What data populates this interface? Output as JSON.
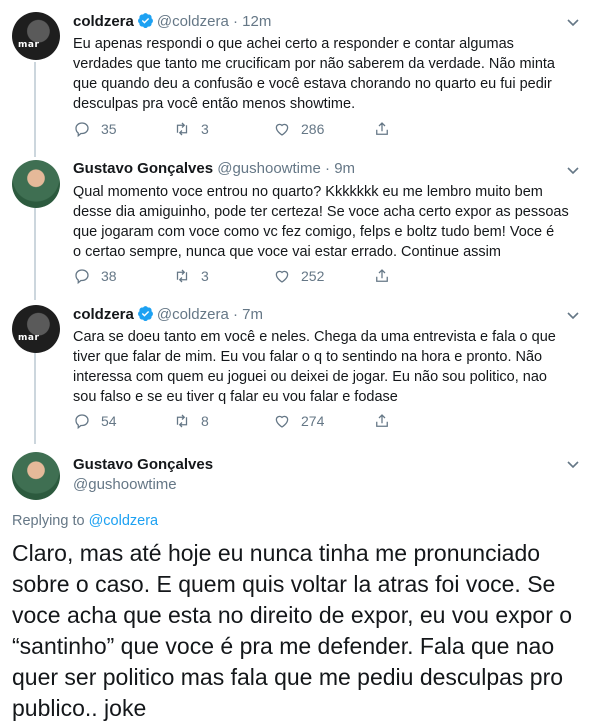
{
  "tweets": [
    {
      "name": "coldzera",
      "verified": true,
      "handle": "@coldzera",
      "dot": "·",
      "time": "12m",
      "avatar_label": "mar",
      "lines": [
        "Eu apenas respondi o que achei certo a responder e contar algumas",
        "verdades que tanto me crucificam por não saberem da verdade. Não minta",
        "que quando deu a confusão e você estava chorando no quarto eu fui pedir",
        "desculpas pra você então menos showtime."
      ],
      "replies": "35",
      "retweets": "3",
      "likes": "286"
    },
    {
      "name": "Gustavo Gonçalves",
      "verified": false,
      "handle": "@gushoowtime",
      "dot": "·",
      "time": "9m",
      "lines": [
        "Qual momento voce entrou no quarto? Kkkkkkk eu me lembro muito bem",
        "desse dia amiguinho, pode ter certeza! Se voce acha certo expor as pessoas",
        "que jogaram com voce como vc fez comigo, felps e boltz tudo bem! Voce é",
        "o certao sempre, nunca que voce vai estar errado. Continue assim"
      ],
      "replies": "38",
      "retweets": "3",
      "likes": "252"
    },
    {
      "name": "coldzera",
      "verified": true,
      "handle": "@coldzera",
      "dot": "·",
      "time": "7m",
      "avatar_label": "mar",
      "lines": [
        "Cara se doeu tanto em você e neles. Chega da uma entrevista e fala o que",
        "tiver que falar de mim. Eu vou falar o q to sentindo na hora e pronto. Não",
        "interessa com quem eu joguei ou deixei de jogar. Eu não sou politico, nao",
        "sou falso e se eu tiver q falar eu vou falar e fodase"
      ],
      "replies": "54",
      "retweets": "8",
      "likes": "274"
    }
  ],
  "main_tweet": {
    "name": "Gustavo Gonçalves",
    "handle": "@gushoowtime",
    "replying_prefix": "Replying to",
    "replying_to": "@coldzera",
    "lines": [
      "Claro, mas até hoje eu nunca tinha me pronunciado",
      "sobre o caso. E quem quis voltar la atras foi voce. Se",
      "voce acha que esta no direito de expor, eu vou expor o",
      "“santinho” que voce é pra me defender. Fala que nao",
      "quer ser politico mas fala que me pediu desculpas pro",
      "publico.. joke"
    ]
  },
  "colors": {
    "text": "#14171a",
    "secondary": "#657786",
    "link": "#1da1f2",
    "divider": "#e6ecf0",
    "verified": "#1da1f2"
  },
  "icons": [
    "verified-badge-icon",
    "chevron-down-icon",
    "reply-icon",
    "retweet-icon",
    "like-icon",
    "share-icon"
  ]
}
